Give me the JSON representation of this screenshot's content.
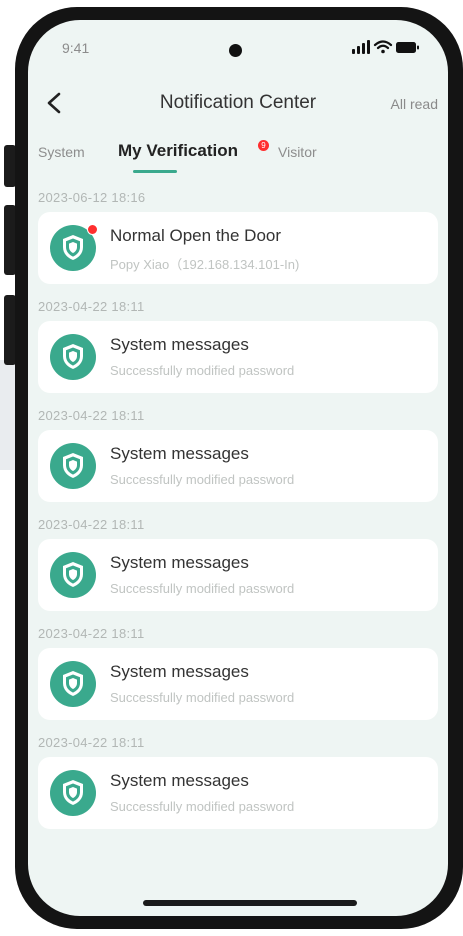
{
  "status_bar": {
    "time": "9:41",
    "icons": [
      "signal-icon",
      "wifi-icon",
      "battery-icon"
    ]
  },
  "nav": {
    "title": "Notification Center",
    "all_read": "All read",
    "back_icon": "chevron-left-icon"
  },
  "tabs": [
    {
      "label": "System",
      "active": false
    },
    {
      "label": "My Verification",
      "active": true,
      "badge": "9"
    },
    {
      "label": "Visitor",
      "active": false
    }
  ],
  "colors": {
    "accent": "#3aa98d",
    "badge": "#ff2e2e",
    "background": "#eef5f3"
  },
  "messages": [
    {
      "timestamp": "2023-06-12 18:16",
      "title": "Normal Open the Door",
      "subtitle": "Popy Xiao（192.168.134.101-In)",
      "unread": true,
      "icon": "shield-icon"
    },
    {
      "timestamp": "2023-04-22 18:11",
      "title": "System messages",
      "subtitle": "Successfully modified password",
      "unread": false,
      "icon": "shield-icon"
    },
    {
      "timestamp": "2023-04-22 18:11",
      "title": "System messages",
      "subtitle": "Successfully modified password",
      "unread": false,
      "icon": "shield-icon"
    },
    {
      "timestamp": "2023-04-22 18:11",
      "title": "System messages",
      "subtitle": "Successfully modified password",
      "unread": false,
      "icon": "shield-icon"
    },
    {
      "timestamp": "2023-04-22 18:11",
      "title": "System messages",
      "subtitle": "Successfully modified password",
      "unread": false,
      "icon": "shield-icon"
    },
    {
      "timestamp": "2023-04-22 18:11",
      "title": "System messages",
      "subtitle": "Successfully modified password",
      "unread": false,
      "icon": "shield-icon"
    }
  ]
}
